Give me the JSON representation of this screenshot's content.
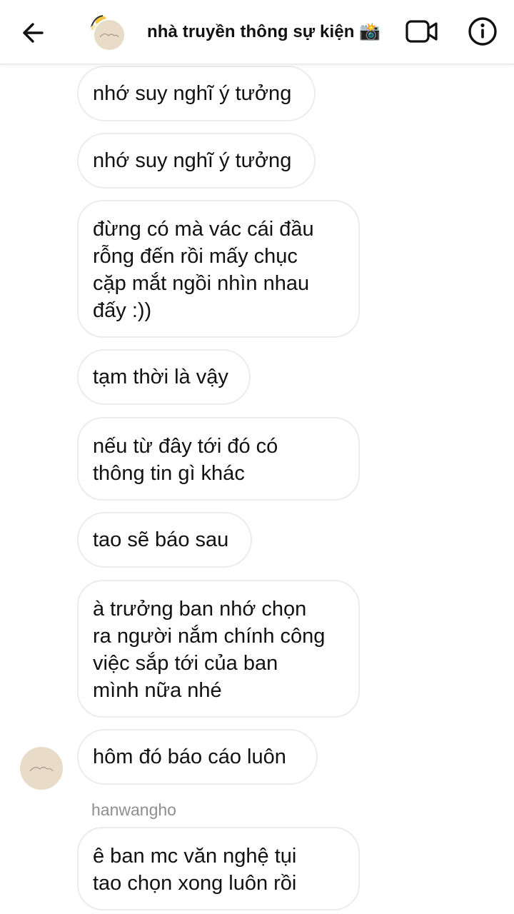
{
  "header": {
    "title": "nhà truyền thông sự kiện 📸"
  },
  "messages": [
    {
      "text": "nhớ suy nghĩ ý tưởng"
    },
    {
      "text": "nhớ suy nghĩ ý tưởng"
    },
    {
      "lines": [
        "đừng có mà vác cái đầu",
        "rỗng đến rồi mấy chục",
        "cặp mắt ngồi nhìn nhau",
        "đấy :))"
      ]
    },
    {
      "text": "tạm thời là vậy"
    },
    {
      "lines": [
        "nếu từ đây tới đó có",
        "thông tin gì khác"
      ]
    },
    {
      "text": "tao sẽ báo sau"
    },
    {
      "lines": [
        "à trưởng ban nhớ chọn",
        "ra người nắm chính công",
        "việc sắp tới của ban",
        "mình nữa nhé"
      ]
    },
    {
      "text": "hôm đó báo cáo luôn"
    }
  ],
  "next_sender": "hanwangho",
  "next_message": {
    "lines": [
      "ê ban mc văn nghệ tụi",
      "tao chọn xong luôn rồi"
    ]
  },
  "icons": {
    "back": "arrow-left-icon",
    "video": "video-camera-icon",
    "info": "info-icon"
  },
  "colors": {
    "bubble_border": "#ececec",
    "avatar_bg": "#e8dcc9",
    "sender_name": "#8e8e8e"
  }
}
